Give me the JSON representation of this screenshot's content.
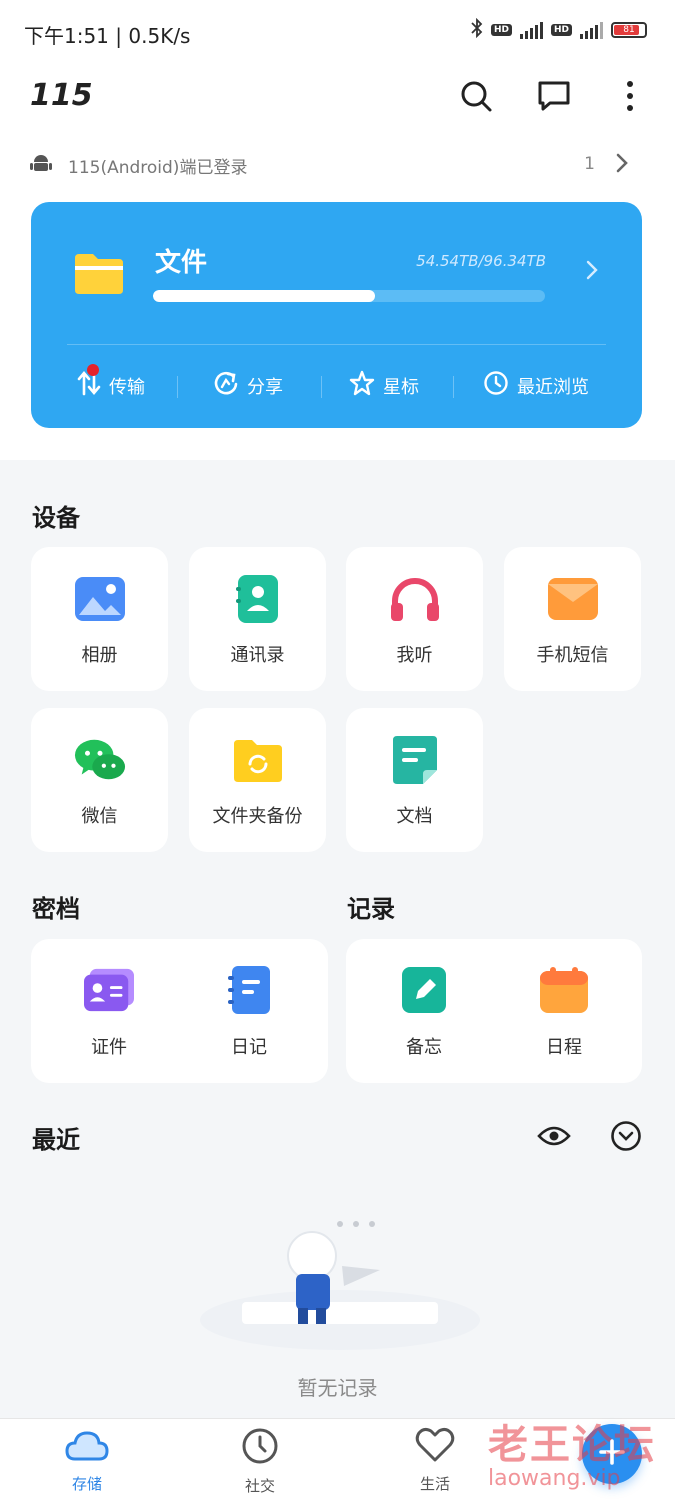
{
  "status_bar": {
    "time": "下午1:51",
    "speed": "0.5K/s",
    "net_type": "5G",
    "hd": "HD",
    "battery": "81"
  },
  "app_bar": {
    "title": "115",
    "icons": [
      "search-icon",
      "message-icon",
      "more-vertical-icon"
    ]
  },
  "login": {
    "text": "115(Android)端已登录",
    "count": "1"
  },
  "file_card": {
    "title": "文件",
    "usage": "54.54TB/96.34TB",
    "usage_fraction": 0.566,
    "bg_color": "#2fa7f2",
    "actions": [
      {
        "label": "传输",
        "icon": "transfer-icon",
        "badge": true
      },
      {
        "label": "分享",
        "icon": "share-icon"
      },
      {
        "label": "星标",
        "icon": "star-icon"
      },
      {
        "label": "最近浏览",
        "icon": "history-icon"
      }
    ]
  },
  "devices": {
    "title": "设备",
    "items": [
      {
        "label": "相册",
        "icon": "album-icon"
      },
      {
        "label": "通讯录",
        "icon": "contacts-icon"
      },
      {
        "label": "我听",
        "icon": "headphones-icon"
      },
      {
        "label": "手机短信",
        "icon": "sms-icon"
      },
      {
        "label": "微信",
        "icon": "wechat-icon"
      },
      {
        "label": "文件夹备份",
        "icon": "folder-backup-icon"
      },
      {
        "label": "文档",
        "icon": "document-icon"
      }
    ]
  },
  "vault": {
    "title": "密档",
    "items": [
      {
        "label": "证件",
        "icon": "id-card-icon"
      },
      {
        "label": "日记",
        "icon": "diary-icon"
      }
    ]
  },
  "records": {
    "title": "记录",
    "items": [
      {
        "label": "备忘",
        "icon": "memo-icon"
      },
      {
        "label": "日程",
        "icon": "calendar-icon"
      }
    ]
  },
  "recent": {
    "title": "最近",
    "empty_text": "暂无记录",
    "icons": [
      "eye-icon",
      "chevron-down-circle-icon"
    ]
  },
  "tabbar": {
    "tabs": [
      {
        "label": "存储",
        "icon": "cloud-icon",
        "active": true
      },
      {
        "label": "社交",
        "icon": "clock-icon"
      },
      {
        "label": "生活",
        "icon": "heart-icon"
      }
    ],
    "fab_icon": "plus-icon"
  },
  "watermark": {
    "cn": "老王论坛",
    "en": "laowang.vip"
  },
  "colors": {
    "primary": "#2fa7f2",
    "accent": "#2a8ff0",
    "badge": "#e5232b"
  }
}
